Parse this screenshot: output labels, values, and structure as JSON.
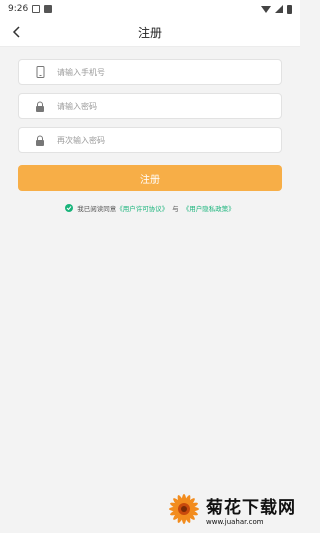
{
  "status_bar": {
    "time": "9:26"
  },
  "header": {
    "title": "注册"
  },
  "form": {
    "phone_placeholder": "请输入手机号",
    "password_placeholder": "请输入密码",
    "confirm_placeholder": "再次输入密码",
    "register_label": "注册"
  },
  "agreement": {
    "prefix": "我已阅读同意",
    "user_license": "《用户许可协议》",
    "and": "与",
    "privacy_policy": "《用户隐私政策》"
  },
  "watermark": {
    "title": "菊花下载网",
    "url": "www.juahar.com"
  },
  "colors": {
    "accent": "#f7ae47",
    "link": "#19b47b"
  }
}
